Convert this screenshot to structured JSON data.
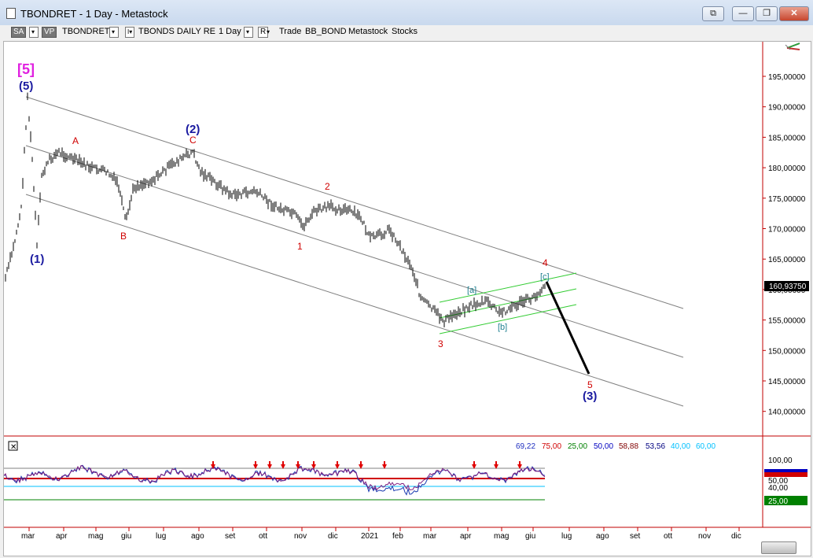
{
  "window": {
    "title": "TBONDRET - 1 Day - Metastock",
    "buttons": [
      "⧉",
      "—",
      "❐",
      "✕"
    ]
  },
  "toolbar": {
    "sa": "SA",
    "vp": "VP",
    "symbol": "TBONDRET",
    "security_name": "TBONDS DAILY RE",
    "period": "1 Day",
    "r": "R",
    "items": [
      "Trade",
      "BB_BOND",
      "Metastock",
      "Stocks"
    ]
  },
  "price_axis": {
    "labels": [
      "195,00000",
      "190,00000",
      "185,00000",
      "180,00000",
      "175,00000",
      "170,00000",
      "165,00000",
      "160,00000",
      "155,00000",
      "150,00000",
      "145,00000",
      "140,00000"
    ],
    "current": "160,93750"
  },
  "time_axis": {
    "labels": [
      "mar",
      "apr",
      "mag",
      "giu",
      "lug",
      "ago",
      "set",
      "ott",
      "nov",
      "dic",
      "2021",
      "feb",
      "mar",
      "apr",
      "mag",
      "giu",
      "lug",
      "ago",
      "set",
      "ott",
      "nov",
      "dic"
    ]
  },
  "wave_labels": {
    "top5": "[5]",
    "w5": "(5)",
    "w1": "(1)",
    "wA": "A",
    "wB": "B",
    "wC": "C",
    "w2": "(2)",
    "s1": "1",
    "s2": "2",
    "s3": "3",
    "s4": "4",
    "s5": "5",
    "w3": "(3)",
    "a": "[a]",
    "b": "[b]",
    "c": "[c]"
  },
  "indicator": {
    "values": [
      "69,22",
      "75,00",
      "25,00",
      "50,00",
      "58,88",
      "53,56",
      "40,00",
      "60,00"
    ],
    "value_colors": [
      "#2030c0",
      "#d00000",
      "#008000",
      "#0000c0",
      "#800000",
      "#000080",
      "#00c0ff",
      "#00c0ff"
    ],
    "axis_labels": [
      "100,00",
      "50,00",
      "40,00",
      "25,00"
    ],
    "panel_box_icon": "x-icon"
  },
  "colors": {
    "price_bars": "#000000",
    "channel_lines": "#808080",
    "green_channel": "#33cc33",
    "wave_red": "#d00000",
    "wave_blue": "#1a1aa0",
    "wave_magenta": "#e020e0",
    "wave_teal": "#208090",
    "separator": "#c00000"
  }
}
